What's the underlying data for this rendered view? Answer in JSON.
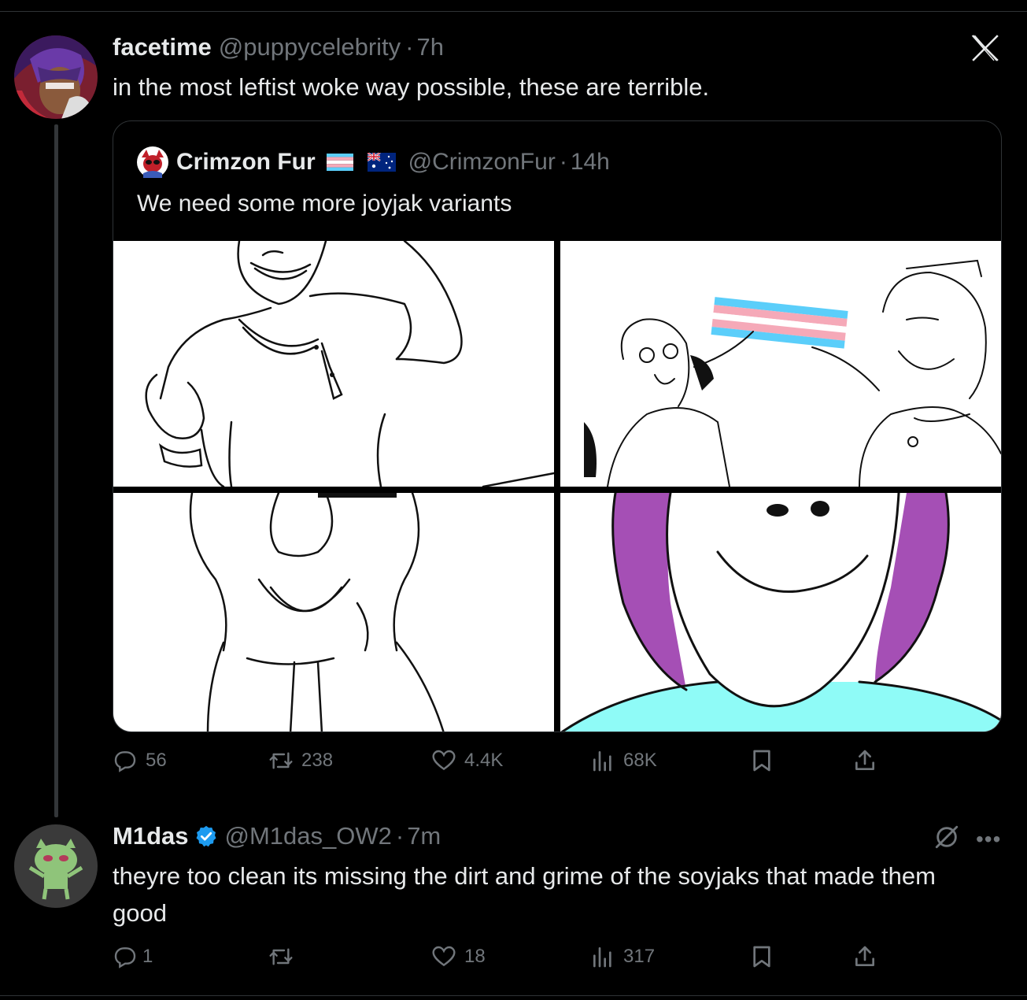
{
  "post": {
    "author_name": "facetime",
    "author_handle": "@puppycelebrity",
    "separator": "·",
    "time": "7h",
    "text": "in the most leftist woke way possible, these are terrible.",
    "avatar_icon": "anime-avatar-icon"
  },
  "quote": {
    "author_name": "Crimzon Fur",
    "flags": [
      "transgender-flag-icon",
      "australia-flag-icon"
    ],
    "author_handle": "@CrimzonFur",
    "separator": "·",
    "time": "14h",
    "text": "We need some more joyjak variants"
  },
  "post_actions": {
    "replies": "56",
    "reposts": "238",
    "likes": "4.4K",
    "views": "68K"
  },
  "reply": {
    "author_name": "M1das",
    "verified": true,
    "author_handle": "@M1das_OW2",
    "separator": "·",
    "time": "7m",
    "text": "theyre too clean its missing the dirt and grime of the soyjaks that made them good",
    "actions": {
      "replies": "1",
      "reposts": "",
      "likes": "18",
      "views": "317"
    }
  },
  "colors": {
    "background": "#000000",
    "text": "#e7e9ea",
    "muted": "#71767b",
    "border": "#2f3336",
    "verified": "#1d9bf0",
    "joyjak_hair": "#a54fb5",
    "joyjak_shirt": "#8ffbf7"
  }
}
